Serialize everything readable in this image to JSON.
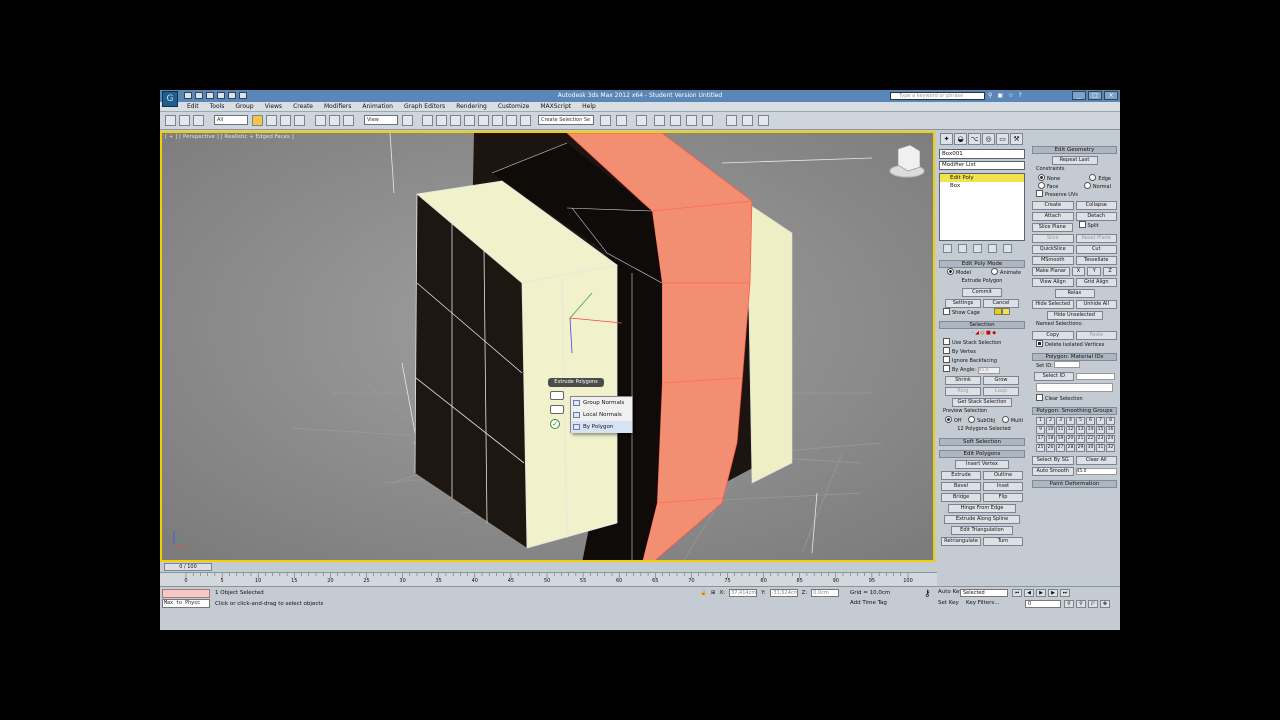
{
  "title": "Autodesk 3ds Max  2012 x64  -  Student Version     Untitled",
  "search_placeholder": "Type a keyword or phrase",
  "menu": [
    "Edit",
    "Tools",
    "Group",
    "Views",
    "Create",
    "Modifiers",
    "Animation",
    "Graph Editors",
    "Rendering",
    "Customize",
    "MAXScript",
    "Help"
  ],
  "toolbar": {
    "selection_filter": "All",
    "ref_coord": "View",
    "named_selection": "Create Selection Se"
  },
  "viewport": {
    "label": "[ + ] [ Perspective ] [ Realistic + Edged Faces ]"
  },
  "caddy": {
    "title": "Extrude Polygons",
    "options": [
      "Group Normals",
      "Local Normals",
      "By Polygon"
    ]
  },
  "command_panel": {
    "object_name": "Box001",
    "modifier_list": "Modifier List",
    "stack": [
      "Edit Poly",
      "Box"
    ],
    "edit_poly_mode": {
      "title": "Edit Poly Mode",
      "model": "Model",
      "animate": "Animate",
      "operation": "Extrude Polygon",
      "commit": "Commit",
      "settings": "Settings",
      "cancel": "Cancel",
      "show_cage": "Show Cage"
    },
    "selection": {
      "title": "Selection",
      "use_stack": "Use Stack Selection",
      "by_vertex": "By Vertex",
      "ignore_backfacing": "Ignore Backfacing",
      "by_angle": "By Angle:",
      "by_angle_value": "45.0",
      "shrink": "Shrink",
      "grow": "Grow",
      "ring": "Ring",
      "loop": "Loop",
      "get_stack": "Get Stack Selection",
      "preview": "Preview Selection",
      "off": "Off",
      "subobj": "SubObj",
      "multi": "Multi",
      "status": "12 Polygons Selected"
    },
    "soft_selection": "Soft Selection",
    "edit_polygons": {
      "title": "Edit Polygons",
      "insert_vertex": "Insert Vertex",
      "extrude": "Extrude",
      "outline": "Outline",
      "bevel": "Bevel",
      "inset": "Inset",
      "bridge": "Bridge",
      "flip": "Flip",
      "hinge": "Hinge From Edge",
      "extrude_spline": "Extrude Along Spline",
      "edit_tri": "Edit Triangulation",
      "retriangulate": "Retriangulate",
      "turn": "Turn"
    },
    "edit_geometry": {
      "title": "Edit Geometry",
      "repeat_last": "Repeat Last",
      "constraints": "Constraints",
      "none": "None",
      "edge": "Edge",
      "face": "Face",
      "normal": "Normal",
      "preserve_uvs": "Preserve UVs",
      "create": "Create",
      "collapse": "Collapse",
      "attach": "Attach",
      "detach": "Detach",
      "slice_plane": "Slice Plane",
      "split": "Split",
      "slice": "Slice",
      "reset_plane": "Reset Plane",
      "quickslice": "QuickSlice",
      "cut": "Cut",
      "msmooth": "MSmooth",
      "tessellate": "Tessellate",
      "make_planar": "Make Planar",
      "x": "X",
      "y": "Y",
      "z": "Z",
      "view_align": "View Align",
      "grid_align": "Grid Align",
      "relax": "Relax",
      "hide_selected": "Hide Selected",
      "unhide_all": "Unhide All",
      "hide_unselected": "Hide Unselected",
      "named_selections": "Named Selections:",
      "copy": "Copy",
      "paste": "Paste",
      "delete_isolated": "Delete Isolated Vertices"
    },
    "material_ids": {
      "title": "Polygon: Material IDs",
      "set_id": "Set ID:",
      "select_id": "Select ID",
      "clear_selection": "Clear Selection"
    },
    "smoothing": {
      "title": "Polygon: Smoothing Groups",
      "groups": [
        "1",
        "2",
        "3",
        "4",
        "5",
        "6",
        "7",
        "8",
        "9",
        "10",
        "11",
        "12",
        "13",
        "14",
        "15",
        "16",
        "17",
        "18",
        "19",
        "20",
        "21",
        "22",
        "23",
        "24",
        "25",
        "26",
        "27",
        "28",
        "29",
        "30",
        "31",
        "32"
      ],
      "select_by_sg": "Select By SG",
      "clear_all": "Clear All",
      "auto_smooth": "Auto Smooth",
      "auto_smooth_value": "45.0"
    },
    "paint_deformation": "Paint Deformation"
  },
  "timeline": {
    "frame": "0 / 100",
    "ticks": [
      "0",
      "5",
      "10",
      "15",
      "20",
      "25",
      "30",
      "35",
      "40",
      "45",
      "50",
      "55",
      "60",
      "65",
      "70",
      "75",
      "80",
      "85",
      "90",
      "95",
      "100"
    ]
  },
  "status": {
    "script": "Max to Physc",
    "selected": "1 Object Selected",
    "prompt": "Click or click-and-drag to select objects",
    "x_label": "X:",
    "x": "37,414cm",
    "y_label": "Y:",
    "y": "-31,524cm",
    "z_label": "Z:",
    "z": "0,0cm",
    "grid": "Grid = 10,0cm",
    "add_time_tag": "Add Time Tag",
    "auto_key": "Auto Key",
    "set_key": "Set Key",
    "selected_dd": "Selected",
    "key_filters": "Key Filters...",
    "frame_value": "0"
  }
}
